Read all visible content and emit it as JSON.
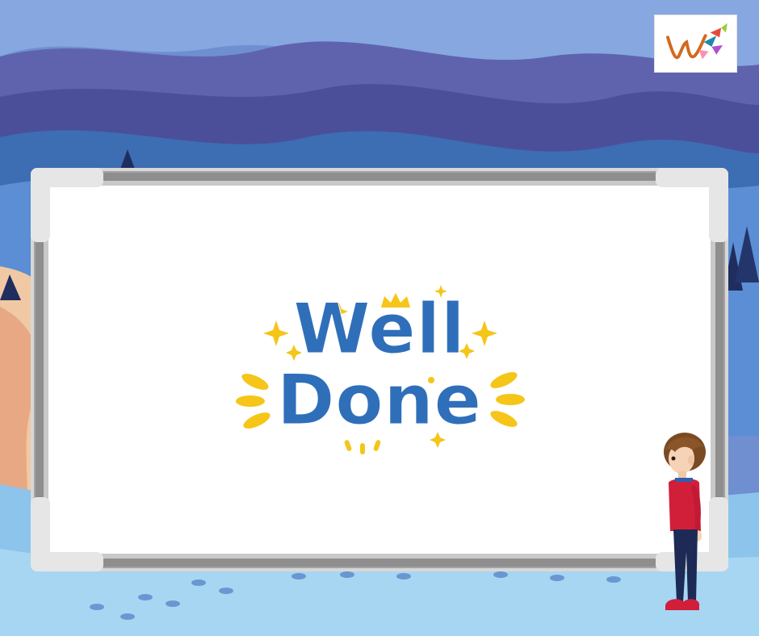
{
  "scene": {
    "message": {
      "line1": "Well",
      "line2": "Done"
    },
    "icons": {
      "logo": "brand-logo-icon",
      "sparkle": "sparkle-icon",
      "crown": "crown-icon",
      "leaf": "leaf-burst-icon"
    },
    "colors": {
      "text": "#2f6fba",
      "accent": "#f5c518",
      "board_frame": "#9a9a9a",
      "board_surface": "#ffffff",
      "sky": "#5c7fc4",
      "mountain": "#4a55a0",
      "shirt": "#d11f3a"
    }
  }
}
